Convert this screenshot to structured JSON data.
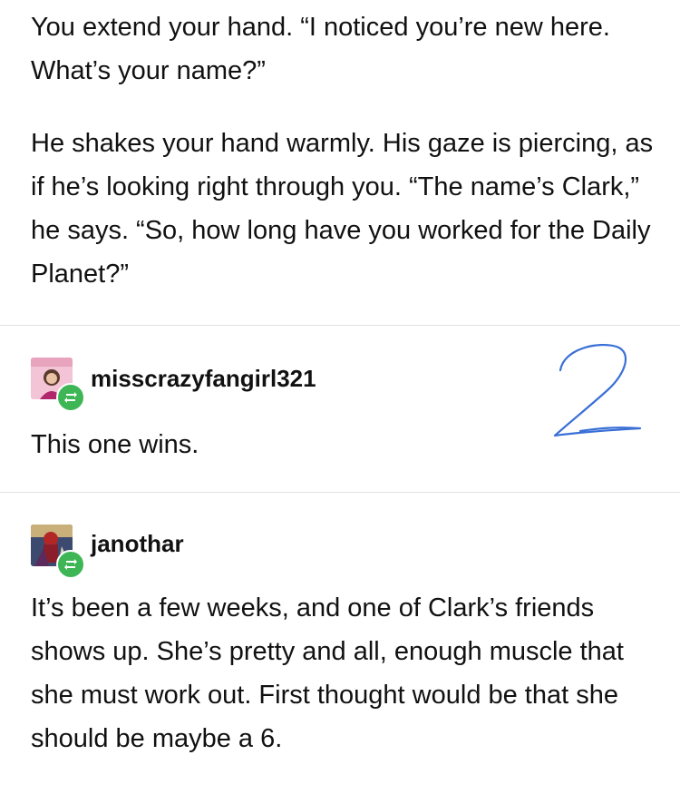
{
  "post": {
    "paragraph_1": "You extend your hand. “I noticed you’re new here. What’s your name?”",
    "paragraph_2": "He shakes your hand warmly. His gaze is piercing, as if he’s looking right through you. “The name’s Clark,” he says. “So, how long have you worked for the Daily Planet?”"
  },
  "reblogs": [
    {
      "username": "misscrazyfangirl321",
      "text": "This one wins.",
      "avatar_icon": "avatar-image",
      "badge_icon": "reblog-icon"
    },
    {
      "username": "janothar",
      "text": "It’s been a few weeks, and one of Clark’s friends shows up.  She’s pretty and all, enough muscle that she must work out. First thought would be that she should be maybe a 6.",
      "avatar_icon": "avatar-image",
      "badge_icon": "reblog-icon"
    }
  ],
  "annotation": {
    "icon": "handwritten-number",
    "color": "#3a6fd6"
  },
  "colors": {
    "text": "#111111",
    "divider": "#e2e2e2",
    "reblog_badge": "#3eb655"
  }
}
